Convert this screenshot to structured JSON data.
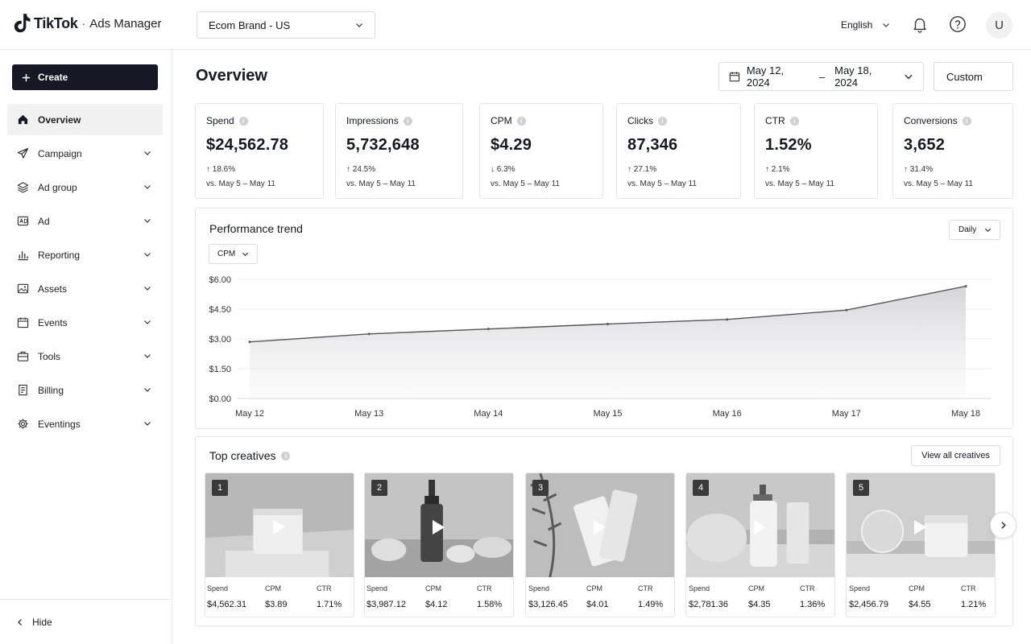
{
  "header": {
    "brand": "TikTok",
    "separator": "·",
    "product": "Ads Manager",
    "account": "Ecom Brand - US",
    "language": "English",
    "avatar_initial": "U"
  },
  "sidebar": {
    "create_label": "Create",
    "items": [
      {
        "label": "Overview",
        "icon": "home-icon",
        "active": true
      },
      {
        "label": "Campaign",
        "icon": "send-icon"
      },
      {
        "label": "Ad group",
        "icon": "layers-icon"
      },
      {
        "label": "Ad",
        "icon": "ad-icon"
      },
      {
        "label": "Reporting",
        "icon": "bar-chart-icon"
      },
      {
        "label": "Assets",
        "icon": "image-icon"
      },
      {
        "label": "Events",
        "icon": "calendar-icon"
      },
      {
        "label": "Tools",
        "icon": "briefcase-icon"
      },
      {
        "label": "Billing",
        "icon": "receipt-icon"
      },
      {
        "label": "Eventings",
        "icon": "gear-icon"
      }
    ],
    "hide_label": "Hide"
  },
  "main": {
    "title": "Overview",
    "date_start": "May 12, 2024",
    "date_sep": "–",
    "date_end": "May 18, 2024",
    "custom_label": "Custom"
  },
  "kpis": [
    {
      "label": "Spend",
      "value": "$24,562.78",
      "change": "↑ 18.6%",
      "compare": "vs. May 5 – May 11"
    },
    {
      "label": "Impressions",
      "value": "5,732,648",
      "change": "↑ 24.5%",
      "compare": "vs. May 5 – May 11"
    },
    {
      "label": "CPM",
      "value": "$4.29",
      "change": "↓ 6.3%",
      "compare": "vs. May 5 – May 11"
    },
    {
      "label": "Clicks",
      "value": "87,346",
      "change": "↑ 27.1%",
      "compare": "vs. May 5 – May 11"
    },
    {
      "label": "CTR",
      "value": "1.52%",
      "change": "↑ 2.1%",
      "compare": "vs. May 5 – May 11"
    },
    {
      "label": "Conversions",
      "value": "3,652",
      "change": "↑ 31.4%",
      "compare": "vs. May 5 – May 11"
    }
  ],
  "trend": {
    "title": "Performance trend",
    "metric": "CPM",
    "granularity": "Daily"
  },
  "chart_data": {
    "type": "area",
    "x": [
      "May 12",
      "May 13",
      "May 14",
      "May 15",
      "May 16",
      "May 17",
      "May 18"
    ],
    "series": [
      {
        "name": "CPM",
        "values": [
          2.85,
          3.25,
          3.5,
          3.75,
          3.98,
          4.45,
          5.65
        ]
      }
    ],
    "y_ticks": [
      "$0.00",
      "$1.50",
      "$3.00",
      "$4.50",
      "$6.00"
    ],
    "ylim": [
      0,
      6
    ],
    "grid": true
  },
  "creatives": {
    "title": "Top creatives",
    "view_all": "View all creatives",
    "stat_labels": {
      "spend": "Spend",
      "cpm": "CPM",
      "ctr": "CTR"
    },
    "items": [
      {
        "rank": "1",
        "spend": "$4,562.31",
        "cpm": "$3.89",
        "ctr": "1.71%"
      },
      {
        "rank": "2",
        "spend": "$3,987.12",
        "cpm": "$4.12",
        "ctr": "1.58%"
      },
      {
        "rank": "3",
        "spend": "$3,126.45",
        "cpm": "$4.01",
        "ctr": "1.49%"
      },
      {
        "rank": "4",
        "spend": "$2,781.36",
        "cpm": "$4.35",
        "ctr": "1.36%"
      },
      {
        "rank": "5",
        "spend": "$2,456.79",
        "cpm": "$4.55",
        "ctr": "1.21%"
      }
    ]
  }
}
